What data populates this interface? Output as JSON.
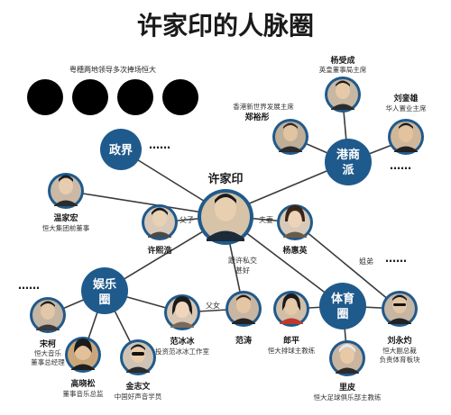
{
  "title": "许家印的人脉圈",
  "politics_note": "粤穗两地领导多次捧场恒大",
  "ellipsis": "……",
  "center": {
    "name": "许家印"
  },
  "hubs": {
    "politics": {
      "label": "政界"
    },
    "hk_business": {
      "label_line1": "港商",
      "label_line2": "派"
    },
    "entertainment": {
      "label_line1": "娱乐",
      "label_line2": "圈"
    },
    "sports": {
      "label_line1": "体育",
      "label_line2": "圈"
    }
  },
  "people": {
    "wen_jiahong": {
      "name": "温家宏",
      "role_line1": "恒大集团前董事",
      "role_line2": ""
    },
    "xu_xihao": {
      "name": "许熙浩",
      "role_line1": "",
      "role_line2": ""
    },
    "yang_huiying": {
      "name": "杨惠英",
      "role_line1": "",
      "role_line2": ""
    },
    "yang_shoucheng": {
      "name": "杨受成",
      "role_line1": "英皇董事局主席",
      "role_line2": ""
    },
    "zheng_yutong": {
      "name": "郑裕彤",
      "role_line1": "香港新世界发展主席",
      "role_line2": ""
    },
    "liu_luanxiong": {
      "name": "刘銮雄",
      "role_line1": "华人置业主席",
      "role_line2": ""
    },
    "song_ke": {
      "name": "宋柯",
      "role_line1": "恒大音乐",
      "role_line2": "董事总经理"
    },
    "gao_xiaosong": {
      "name": "高晓松",
      "role_line1": "董事音乐总监",
      "role_line2": ""
    },
    "jin_zhiwen": {
      "name": "金志文",
      "role_line1": "中国好声音学员",
      "role_line2": ""
    },
    "fan_bingbing": {
      "name": "范冰冰",
      "role_line1": "投资范冰冰工作室",
      "role_line2": ""
    },
    "fan_tao": {
      "name": "范涛",
      "role_line1": "",
      "role_line2": ""
    },
    "lang_ping": {
      "name": "郎平",
      "role_line1": "恒大排球主教练",
      "role_line2": ""
    },
    "li_pi": {
      "name": "里皮",
      "role_line1": "恒大足球俱乐部主教练",
      "role_line2": ""
    },
    "liu_yongzhuo": {
      "name": "刘永灼",
      "role_line1": "恒大副总裁",
      "role_line2": "负责体育板块"
    }
  },
  "edge_labels": {
    "father_son": "父子",
    "husband_wife": "夫妻",
    "private_line1": "跟许私交",
    "private_line2": "甚好",
    "father_daughter": "父女",
    "nephew": "姐弟"
  },
  "colors": {
    "hub": "#1f5a8c",
    "edge": "#3a3a3a",
    "redacted": "#000000"
  }
}
